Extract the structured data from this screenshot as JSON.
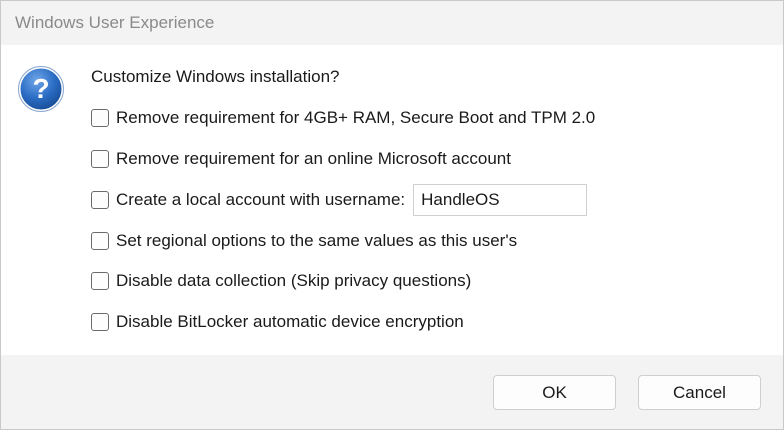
{
  "window": {
    "title": "Windows User Experience"
  },
  "dialog": {
    "icon": "question-icon",
    "question": "Customize Windows installation?",
    "options": [
      {
        "label": "Remove requirement for 4GB+ RAM, Secure Boot and TPM 2.0",
        "checked": false
      },
      {
        "label": "Remove requirement for an online Microsoft account",
        "checked": false
      },
      {
        "label": "Create a local account with username:",
        "checked": false
      },
      {
        "label": "Set regional options to the same values as this user's",
        "checked": false
      },
      {
        "label": "Disable data collection (Skip privacy questions)",
        "checked": false
      },
      {
        "label": "Disable BitLocker automatic device encryption",
        "checked": false
      }
    ],
    "username_value": "HandleOS"
  },
  "buttons": {
    "ok": "OK",
    "cancel": "Cancel"
  },
  "colors": {
    "icon_blue": "#1f5fb0",
    "titlebar_bg": "#f3f3f3",
    "title_text": "#8a8a8a"
  }
}
